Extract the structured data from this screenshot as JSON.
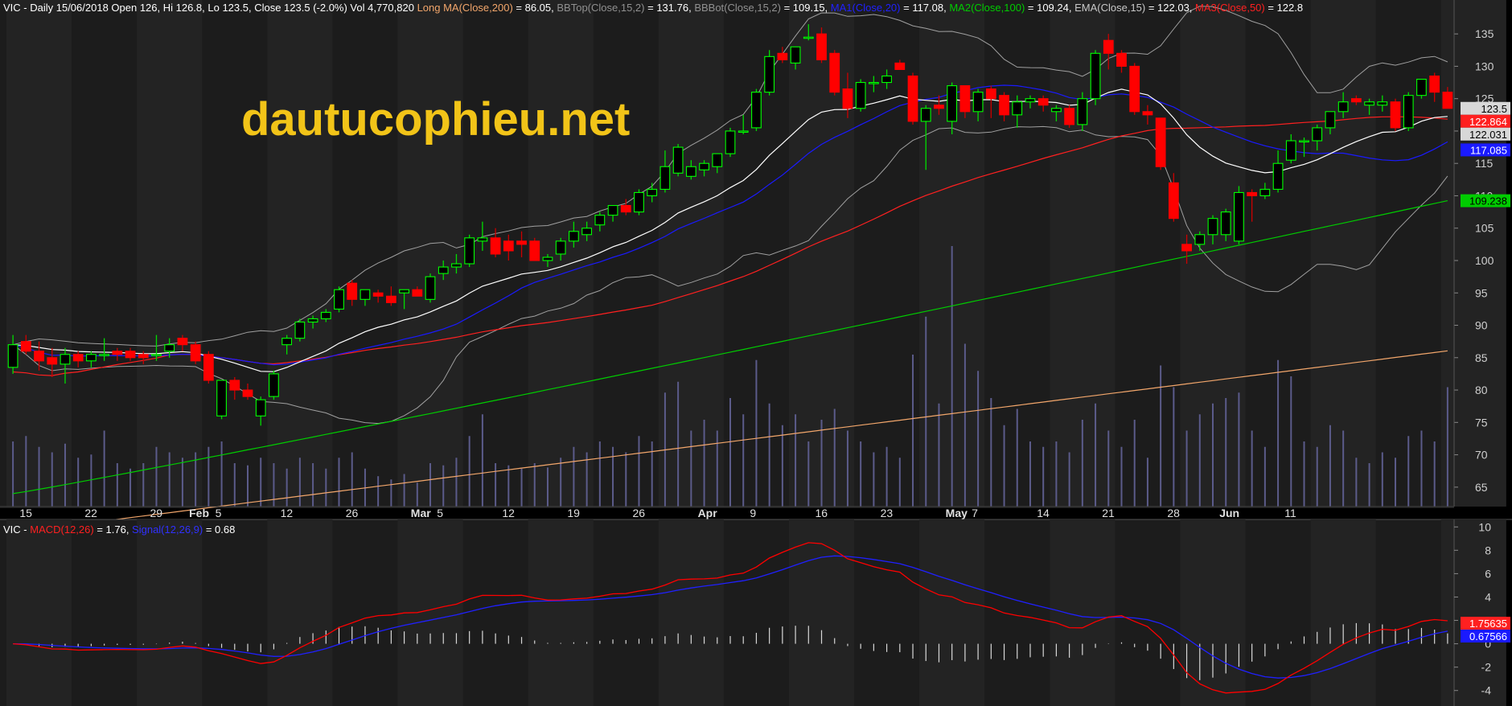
{
  "colors": {
    "background": "#000000",
    "pane_background": "#1c1c1c",
    "stripe": "#232323",
    "up_candle": "#00ff00",
    "down_candle": "#ff0000",
    "volume": "#5b5b8a",
    "watermark": "#f2c418",
    "bb": "#a0a0a0",
    "ema": "#ffffff",
    "ma1": "#1a1aff",
    "ma2": "#00cc00",
    "ma3": "#ff2020",
    "long_ma": "#f2a66b",
    "macd": "#ff0000",
    "signal": "#2020ff"
  },
  "watermark": "dautucophieu.net",
  "price_header": {
    "prefix": "VIC - Daily 15/06/2018 Open 126, Hi 126.8, Lo 123.5, Close 123.5 (-2.0%) Vol 4,770,820",
    "items": [
      {
        "label": "Long MA(Close,200)",
        "value": "= 86.05,",
        "color": "#f2a66b"
      },
      {
        "label": "BBTop(Close,15,2)",
        "value": "= 131.76,",
        "color": "#909090"
      },
      {
        "label": "BBBot(Close,15,2)",
        "value": "= 109.15,",
        "color": "#909090"
      },
      {
        "label": "MA1(Close,20)",
        "value": "= 117.08,",
        "color": "#2020ff"
      },
      {
        "label": "MA2(Close,100)",
        "value": "= 109.24,",
        "color": "#00cc00"
      },
      {
        "label": "EMA(Close,15)",
        "value": "= 122.03,",
        "color": "#c8c8c8"
      },
      {
        "label": "MA3(Close,50)",
        "value": "= 122.8",
        "color": "#ff2020"
      }
    ]
  },
  "macd_header": {
    "prefix": "VIC - ",
    "items": [
      {
        "label": "MACD(12,26)",
        "value": "= 1.76,",
        "color": "#ff2020"
      },
      {
        "label": "Signal(12,26,9)",
        "value": "= 0.68",
        "color": "#3030ff"
      }
    ]
  },
  "price_axis_ticks": [
    "135",
    "130",
    "125",
    "120",
    "115",
    "110",
    "105",
    "100",
    "95",
    "90",
    "85",
    "80",
    "75",
    "70",
    "65"
  ],
  "macd_axis_ticks": [
    "10",
    "8",
    "6",
    "4",
    "2",
    "0",
    "-2",
    "-4"
  ],
  "price_tags": [
    {
      "value": 123.5,
      "label": "123.5",
      "bg": "#d8d8d8",
      "fg": "#000000"
    },
    {
      "value": 122.864,
      "label": "122.864",
      "bg": "#ff2020",
      "fg": "#ffffff"
    },
    {
      "value": 122.031,
      "label": "122.031",
      "bg": "#d8d8d8",
      "fg": "#000000"
    },
    {
      "value": 117.085,
      "label": "117.085",
      "bg": "#1a1aff",
      "fg": "#ffffff"
    },
    {
      "value": 109.238,
      "label": "109.238",
      "bg": "#00cc00",
      "fg": "#000000"
    }
  ],
  "macd_tags": [
    {
      "value": 1.76,
      "label": "1.75635",
      "bg": "#ff2020",
      "fg": "#ffffff"
    },
    {
      "value": 0.68,
      "label": "0.67566",
      "bg": "#1a1aff",
      "fg": "#ffffff"
    }
  ],
  "x_labels": [
    {
      "text": "15",
      "bar": 1,
      "bold": false
    },
    {
      "text": "22",
      "bar": 6,
      "bold": false
    },
    {
      "text": "29",
      "bar": 11,
      "bold": false
    },
    {
      "text": "Feb",
      "bar": 14,
      "bold": true
    },
    {
      "text": "5",
      "bar": 16,
      "bold": false
    },
    {
      "text": "12",
      "bar": 21,
      "bold": false
    },
    {
      "text": "26",
      "bar": 26,
      "bold": false
    },
    {
      "text": "Mar",
      "bar": 31,
      "bold": true
    },
    {
      "text": "5",
      "bar": 33,
      "bold": false
    },
    {
      "text": "12",
      "bar": 38,
      "bold": false
    },
    {
      "text": "19",
      "bar": 43,
      "bold": false
    },
    {
      "text": "26",
      "bar": 48,
      "bold": false
    },
    {
      "text": "Apr",
      "bar": 53,
      "bold": true
    },
    {
      "text": "9",
      "bar": 57,
      "bold": false
    },
    {
      "text": "16",
      "bar": 62,
      "bold": false
    },
    {
      "text": "23",
      "bar": 67,
      "bold": false
    },
    {
      "text": "May",
      "bar": 72,
      "bold": true
    },
    {
      "text": "7",
      "bar": 74,
      "bold": false
    },
    {
      "text": "14",
      "bar": 79,
      "bold": false
    },
    {
      "text": "21",
      "bar": 84,
      "bold": false
    },
    {
      "text": "28",
      "bar": 89,
      "bold": false
    },
    {
      "text": "Jun",
      "bar": 93,
      "bold": true
    },
    {
      "text": "11",
      "bar": 98,
      "bold": false
    }
  ],
  "chart_data": [
    {
      "type": "candlestick",
      "symbol": "VIC",
      "period": "Daily",
      "ylim": [
        62,
        138
      ],
      "candles": [
        {
          "o": 83.5,
          "h": 88.5,
          "l": 82.5,
          "c": 87.0,
          "v": 60
        },
        {
          "o": 87.5,
          "h": 88.5,
          "l": 85.5,
          "c": 86.0,
          "v": 65
        },
        {
          "o": 86.0,
          "h": 87.5,
          "l": 83.0,
          "c": 84.5,
          "v": 55
        },
        {
          "o": 85.0,
          "h": 86.5,
          "l": 82.0,
          "c": 84.0,
          "v": 50
        },
        {
          "o": 84.0,
          "h": 86.5,
          "l": 81.0,
          "c": 85.5,
          "v": 58
        },
        {
          "o": 85.5,
          "h": 86.0,
          "l": 83.5,
          "c": 84.5,
          "v": 45
        },
        {
          "o": 84.5,
          "h": 86.0,
          "l": 83.5,
          "c": 85.5,
          "v": 48
        },
        {
          "o": 85.5,
          "h": 88.0,
          "l": 84.5,
          "c": 85.5,
          "v": 70
        },
        {
          "o": 86.0,
          "h": 86.5,
          "l": 84.5,
          "c": 85.5,
          "v": 40
        },
        {
          "o": 86.0,
          "h": 86.5,
          "l": 84.5,
          "c": 85.0,
          "v": 35
        },
        {
          "o": 85.5,
          "h": 86.0,
          "l": 84.0,
          "c": 85.0,
          "v": 40
        },
        {
          "o": 85.5,
          "h": 88.5,
          "l": 84.5,
          "c": 85.5,
          "v": 55
        },
        {
          "o": 86.0,
          "h": 88.0,
          "l": 85.0,
          "c": 87.0,
          "v": 50
        },
        {
          "o": 88.0,
          "h": 88.5,
          "l": 86.0,
          "c": 87.0,
          "v": 45
        },
        {
          "o": 87.0,
          "h": 87.5,
          "l": 84.0,
          "c": 84.5,
          "v": 50
        },
        {
          "o": 85.5,
          "h": 86.0,
          "l": 81.0,
          "c": 81.5,
          "v": 55
        },
        {
          "o": 76.0,
          "h": 81.5,
          "l": 75.5,
          "c": 81.5,
          "v": 60
        },
        {
          "o": 81.5,
          "h": 82.0,
          "l": 78.5,
          "c": 80.0,
          "v": 40
        },
        {
          "o": 80.0,
          "h": 81.0,
          "l": 78.5,
          "c": 79.0,
          "v": 38
        },
        {
          "o": 76.0,
          "h": 79.0,
          "l": 74.5,
          "c": 78.5,
          "v": 45
        },
        {
          "o": 79.0,
          "h": 83.0,
          "l": 78.5,
          "c": 82.5,
          "v": 40
        },
        {
          "o": 87.0,
          "h": 88.5,
          "l": 85.5,
          "c": 88.0,
          "v": 35
        },
        {
          "o": 88.0,
          "h": 91.0,
          "l": 87.5,
          "c": 90.5,
          "v": 45
        },
        {
          "o": 90.5,
          "h": 91.5,
          "l": 89.5,
          "c": 91.0,
          "v": 40
        },
        {
          "o": 91.0,
          "h": 92.5,
          "l": 90.5,
          "c": 92.0,
          "v": 35
        },
        {
          "o": 92.5,
          "h": 96.0,
          "l": 92.0,
          "c": 95.5,
          "v": 45
        },
        {
          "o": 96.5,
          "h": 97.0,
          "l": 93.0,
          "c": 94.0,
          "v": 50
        },
        {
          "o": 94.0,
          "h": 95.5,
          "l": 93.0,
          "c": 95.5,
          "v": 35
        },
        {
          "o": 95.0,
          "h": 95.5,
          "l": 93.5,
          "c": 94.5,
          "v": 28
        },
        {
          "o": 94.5,
          "h": 96.0,
          "l": 93.0,
          "c": 93.5,
          "v": 25
        },
        {
          "o": 95.0,
          "h": 95.5,
          "l": 92.5,
          "c": 95.5,
          "v": 30
        },
        {
          "o": 95.5,
          "h": 96.0,
          "l": 94.5,
          "c": 94.5,
          "v": 22
        },
        {
          "o": 94.0,
          "h": 98.0,
          "l": 93.5,
          "c": 97.5,
          "v": 40
        },
        {
          "o": 98.0,
          "h": 100.0,
          "l": 97.0,
          "c": 99.0,
          "v": 38
        },
        {
          "o": 99.0,
          "h": 101.0,
          "l": 98.0,
          "c": 99.5,
          "v": 45
        },
        {
          "o": 99.5,
          "h": 104.0,
          "l": 99.0,
          "c": 103.5,
          "v": 65
        },
        {
          "o": 103.0,
          "h": 106.0,
          "l": 101.5,
          "c": 103.5,
          "v": 85
        },
        {
          "o": 103.5,
          "h": 105.0,
          "l": 100.5,
          "c": 101.0,
          "v": 40
        },
        {
          "o": 103.0,
          "h": 104.0,
          "l": 100.0,
          "c": 101.5,
          "v": 38
        },
        {
          "o": 103.0,
          "h": 104.5,
          "l": 100.5,
          "c": 102.5,
          "v": 35
        },
        {
          "o": 103.0,
          "h": 103.5,
          "l": 100.0,
          "c": 100.0,
          "v": 40
        },
        {
          "o": 100.0,
          "h": 101.0,
          "l": 99.0,
          "c": 100.5,
          "v": 36
        },
        {
          "o": 101.0,
          "h": 103.5,
          "l": 100.0,
          "c": 103.0,
          "v": 45
        },
        {
          "o": 103.0,
          "h": 106.0,
          "l": 102.0,
          "c": 104.5,
          "v": 55
        },
        {
          "o": 104.0,
          "h": 106.0,
          "l": 103.0,
          "c": 105.0,
          "v": 50
        },
        {
          "o": 105.5,
          "h": 107.5,
          "l": 104.5,
          "c": 107.0,
          "v": 60
        },
        {
          "o": 107.0,
          "h": 108.5,
          "l": 106.0,
          "c": 108.5,
          "v": 55
        },
        {
          "o": 108.5,
          "h": 109.5,
          "l": 107.0,
          "c": 107.5,
          "v": 50
        },
        {
          "o": 107.5,
          "h": 111.0,
          "l": 107.0,
          "c": 110.5,
          "v": 65
        },
        {
          "o": 110.0,
          "h": 112.0,
          "l": 109.0,
          "c": 111.0,
          "v": 60
        },
        {
          "o": 111.0,
          "h": 117.0,
          "l": 110.5,
          "c": 114.5,
          "v": 105
        },
        {
          "o": 113.5,
          "h": 118.0,
          "l": 113.0,
          "c": 117.5,
          "v": 115
        },
        {
          "o": 113.0,
          "h": 115.5,
          "l": 112.5,
          "c": 114.5,
          "v": 70
        },
        {
          "o": 114.0,
          "h": 115.5,
          "l": 113.0,
          "c": 115.0,
          "v": 80
        },
        {
          "o": 114.5,
          "h": 116.5,
          "l": 113.5,
          "c": 116.5,
          "v": 70
        },
        {
          "o": 116.5,
          "h": 120.5,
          "l": 116.0,
          "c": 120.0,
          "v": 100
        },
        {
          "o": 120.0,
          "h": 122.5,
          "l": 119.5,
          "c": 120.0,
          "v": 85
        },
        {
          "o": 120.5,
          "h": 126.5,
          "l": 120.0,
          "c": 126.0,
          "v": 135
        },
        {
          "o": 126.0,
          "h": 132.5,
          "l": 125.5,
          "c": 131.5,
          "v": 95
        },
        {
          "o": 132.0,
          "h": 133.0,
          "l": 130.5,
          "c": 131.0,
          "v": 75
        },
        {
          "o": 130.5,
          "h": 133.0,
          "l": 129.5,
          "c": 133.0,
          "v": 85
        },
        {
          "o": 134.5,
          "h": 136.5,
          "l": 134.0,
          "c": 134.5,
          "v": 60
        },
        {
          "o": 135.0,
          "h": 136.0,
          "l": 130.5,
          "c": 131.0,
          "v": 80
        },
        {
          "o": 132.0,
          "h": 132.5,
          "l": 125.5,
          "c": 126.0,
          "v": 90
        },
        {
          "o": 126.5,
          "h": 129.0,
          "l": 122.0,
          "c": 123.5,
          "v": 70
        },
        {
          "o": 123.5,
          "h": 128.0,
          "l": 123.0,
          "c": 127.5,
          "v": 60
        },
        {
          "o": 127.5,
          "h": 128.5,
          "l": 126.0,
          "c": 127.5,
          "v": 50
        },
        {
          "o": 127.5,
          "h": 129.5,
          "l": 126.5,
          "c": 128.5,
          "v": 55
        },
        {
          "o": 130.5,
          "h": 131.0,
          "l": 129.5,
          "c": 129.5,
          "v": 45
        },
        {
          "o": 128.5,
          "h": 129.0,
          "l": 121.0,
          "c": 121.5,
          "v": 140
        },
        {
          "o": 121.5,
          "h": 124.0,
          "l": 114.0,
          "c": 123.5,
          "v": 175
        },
        {
          "o": 124.0,
          "h": 125.5,
          "l": 122.5,
          "c": 123.5,
          "v": 95
        },
        {
          "o": 121.5,
          "h": 127.5,
          "l": 119.5,
          "c": 127.0,
          "v": 240
        },
        {
          "o": 127.0,
          "h": 127.0,
          "l": 122.0,
          "c": 123.0,
          "v": 150
        },
        {
          "o": 123.0,
          "h": 126.5,
          "l": 121.5,
          "c": 126.0,
          "v": 125
        },
        {
          "o": 126.5,
          "h": 127.0,
          "l": 122.0,
          "c": 125.0,
          "v": 100
        },
        {
          "o": 125.5,
          "h": 126.0,
          "l": 121.5,
          "c": 122.5,
          "v": 75
        },
        {
          "o": 122.5,
          "h": 125.5,
          "l": 120.5,
          "c": 124.5,
          "v": 90
        },
        {
          "o": 124.5,
          "h": 125.5,
          "l": 123.5,
          "c": 125.0,
          "v": 60
        },
        {
          "o": 125.0,
          "h": 125.5,
          "l": 123.0,
          "c": 124.0,
          "v": 55
        },
        {
          "o": 123.0,
          "h": 124.0,
          "l": 121.5,
          "c": 123.5,
          "v": 60
        },
        {
          "o": 123.5,
          "h": 124.0,
          "l": 120.5,
          "c": 121.0,
          "v": 50
        },
        {
          "o": 121.0,
          "h": 126.0,
          "l": 120.0,
          "c": 125.0,
          "v": 80
        },
        {
          "o": 125.0,
          "h": 132.5,
          "l": 124.0,
          "c": 132.0,
          "v": 95
        },
        {
          "o": 134.0,
          "h": 135.0,
          "l": 129.5,
          "c": 132.0,
          "v": 70
        },
        {
          "o": 132.0,
          "h": 132.5,
          "l": 129.0,
          "c": 130.0,
          "v": 55
        },
        {
          "o": 130.0,
          "h": 130.5,
          "l": 122.5,
          "c": 123.0,
          "v": 80
        },
        {
          "o": 123.0,
          "h": 124.0,
          "l": 121.0,
          "c": 122.5,
          "v": 45
        },
        {
          "o": 122.0,
          "h": 122.0,
          "l": 114.0,
          "c": 114.5,
          "v": 130
        },
        {
          "o": 112.0,
          "h": 113.5,
          "l": 106.0,
          "c": 106.5,
          "v": 110
        },
        {
          "o": 102.5,
          "h": 104.0,
          "l": 99.5,
          "c": 101.5,
          "v": 70
        },
        {
          "o": 102.5,
          "h": 104.5,
          "l": 101.5,
          "c": 104.0,
          "v": 85
        },
        {
          "o": 104.0,
          "h": 107.0,
          "l": 102.5,
          "c": 106.5,
          "v": 95
        },
        {
          "o": 104.0,
          "h": 108.0,
          "l": 103.0,
          "c": 107.5,
          "v": 100
        },
        {
          "o": 103.0,
          "h": 111.5,
          "l": 102.5,
          "c": 110.5,
          "v": 105
        },
        {
          "o": 110.5,
          "h": 111.0,
          "l": 106.0,
          "c": 110.0,
          "v": 70
        },
        {
          "o": 110.0,
          "h": 112.0,
          "l": 109.5,
          "c": 111.0,
          "v": 55
        },
        {
          "o": 111.0,
          "h": 117.0,
          "l": 110.5,
          "c": 115.0,
          "v": 135
        },
        {
          "o": 115.5,
          "h": 119.5,
          "l": 115.0,
          "c": 118.5,
          "v": 120
        },
        {
          "o": 118.5,
          "h": 119.0,
          "l": 116.0,
          "c": 118.5,
          "v": 60
        },
        {
          "o": 118.5,
          "h": 121.0,
          "l": 117.0,
          "c": 120.5,
          "v": 55
        },
        {
          "o": 120.5,
          "h": 123.0,
          "l": 119.5,
          "c": 123.0,
          "v": 75
        },
        {
          "o": 123.0,
          "h": 126.0,
          "l": 122.0,
          "c": 124.5,
          "v": 70
        },
        {
          "o": 125.0,
          "h": 125.5,
          "l": 124.0,
          "c": 124.5,
          "v": 45
        },
        {
          "o": 124.0,
          "h": 125.0,
          "l": 122.5,
          "c": 124.5,
          "v": 40
        },
        {
          "o": 124.0,
          "h": 125.5,
          "l": 123.0,
          "c": 124.5,
          "v": 50
        },
        {
          "o": 124.5,
          "h": 125.0,
          "l": 120.0,
          "c": 120.5,
          "v": 45
        },
        {
          "o": 120.5,
          "h": 126.0,
          "l": 120.0,
          "c": 125.5,
          "v": 65
        },
        {
          "o": 125.5,
          "h": 128.0,
          "l": 125.0,
          "c": 128.0,
          "v": 70
        },
        {
          "o": 128.5,
          "h": 129.0,
          "l": 124.5,
          "c": 126.0,
          "v": 60
        },
        {
          "o": 126.0,
          "h": 126.8,
          "l": 123.5,
          "c": 123.5,
          "v": 110
        }
      ],
      "overlays": [
        {
          "name": "Long MA(Close,200)",
          "key": "long_ma"
        },
        {
          "name": "BBTop(Close,15,2)",
          "key": "bb_top"
        },
        {
          "name": "BBBot(Close,15,2)",
          "key": "bb_bot"
        },
        {
          "name": "MA1(Close,20)",
          "key": "ma1"
        },
        {
          "name": "MA2(Close,100)",
          "key": "ma2"
        },
        {
          "name": "EMA(Close,15)",
          "key": "ema"
        },
        {
          "name": "MA3(Close,50)",
          "key": "ma3"
        }
      ],
      "last_values": {
        "long_ma": 86.05,
        "bb_top": 131.76,
        "bb_bot": 109.15,
        "ma1": 117.08,
        "ma2": 109.24,
        "ema": 122.03,
        "ma3": 122.86
      }
    },
    {
      "type": "line",
      "name": "MACD",
      "ylim": [
        -4.5,
        10.5
      ],
      "series": [
        {
          "name": "MACD(12,26)",
          "color": "#ff0000"
        },
        {
          "name": "Signal(12,26,9)",
          "color": "#2020ff"
        }
      ],
      "last_values": {
        "macd": 1.76,
        "signal": 0.68
      }
    }
  ]
}
